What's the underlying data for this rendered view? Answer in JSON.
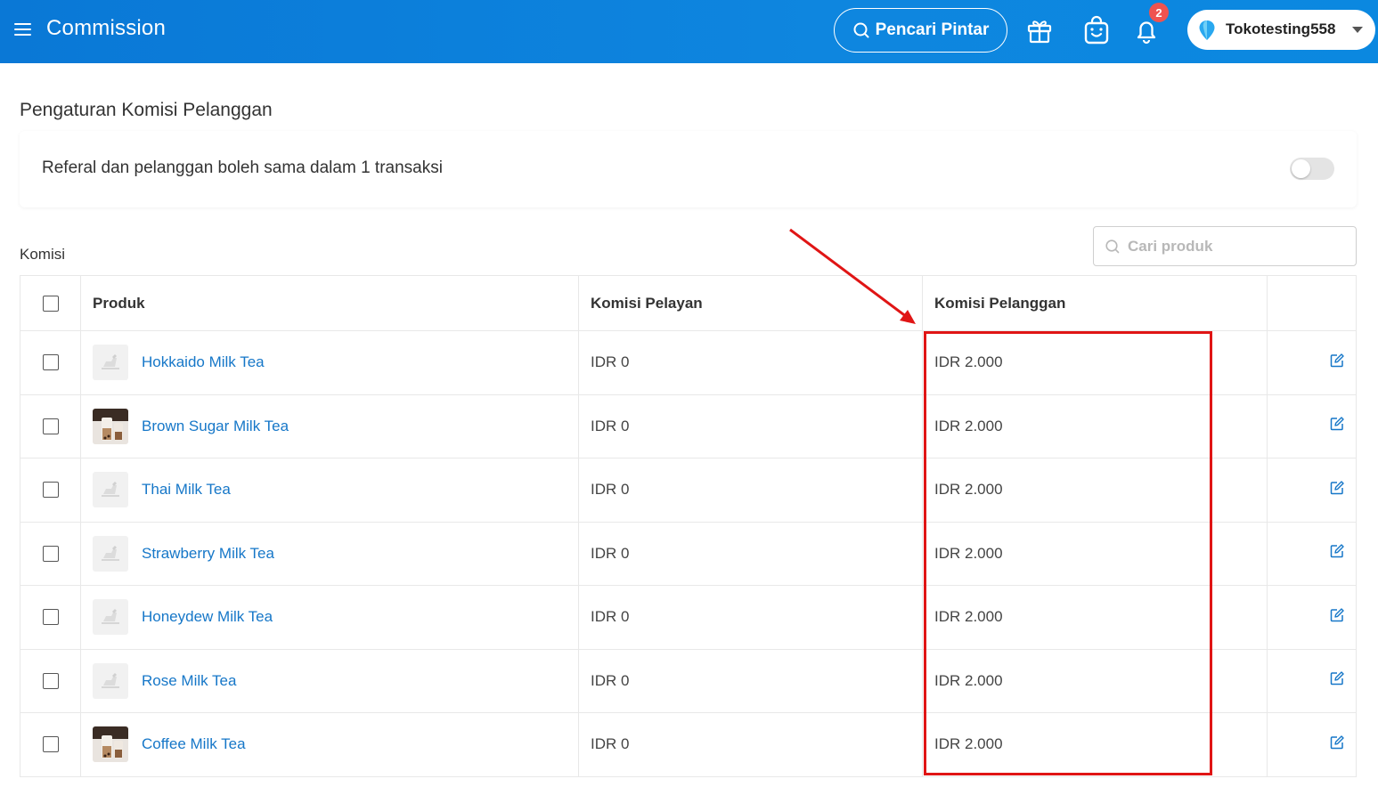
{
  "header": {
    "title": "Commission",
    "smart_search_label": "Pencari Pintar",
    "notification_count": "2",
    "account_name": "Tokotesting558"
  },
  "page": {
    "heading": "Pengaturan Komisi Pelanggan",
    "setting_label": "Referal dan pelanggan boleh sama dalam 1 transaksi",
    "setting_enabled": false,
    "section_label": "Komisi",
    "search_placeholder": "Cari produk"
  },
  "table": {
    "columns": {
      "product": "Produk",
      "staff_commission": "Komisi Pelayan",
      "customer_commission": "Komisi Pelanggan"
    },
    "rows": [
      {
        "product": "Hokkaido Milk Tea",
        "staff": "IDR 0",
        "customer": "IDR 2.000",
        "image": "placeholder"
      },
      {
        "product": "Brown Sugar Milk Tea",
        "staff": "IDR 0",
        "customer": "IDR 2.000",
        "image": "photo"
      },
      {
        "product": "Thai Milk Tea",
        "staff": "IDR 0",
        "customer": "IDR 2.000",
        "image": "placeholder"
      },
      {
        "product": "Strawberry Milk Tea",
        "staff": "IDR 0",
        "customer": "IDR 2.000",
        "image": "placeholder"
      },
      {
        "product": "Honeydew Milk Tea",
        "staff": "IDR 0",
        "customer": "IDR 2.000",
        "image": "placeholder"
      },
      {
        "product": "Rose Milk Tea",
        "staff": "IDR 0",
        "customer": "IDR 2.000",
        "image": "placeholder"
      },
      {
        "product": "Coffee Milk Tea",
        "staff": "IDR 0",
        "customer": "IDR 2.000",
        "image": "photo"
      }
    ]
  },
  "colors": {
    "topbar": "#0a78d6",
    "link": "#1677c8",
    "annotation": "#e01515",
    "badge": "#ef5350"
  }
}
